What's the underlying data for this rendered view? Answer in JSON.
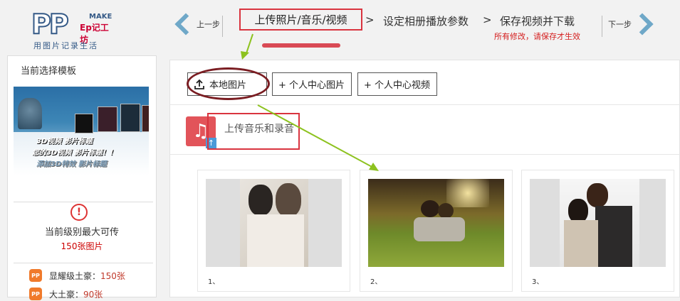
{
  "header": {
    "logo": {
      "pp": "PP",
      "make": "MAKE",
      "brand": "Ep记工坊",
      "slogan": "用图片记录生活"
    },
    "prev_label": "上一步",
    "next_label": "下一步",
    "steps": [
      {
        "label": "上传照片/音乐/视频",
        "active": true
      },
      {
        "label": "设定相册播放参数",
        "active": false
      },
      {
        "label": "保存视频并下载",
        "active": false
      }
    ],
    "separator": ">",
    "save_warning": "所有修改，请保存才生效"
  },
  "sidebar": {
    "title": "当前选择模板",
    "template_preview": {
      "text_line1": "3D视频 影片标题",
      "text_line2": "您的3D视频 影片标题！！",
      "text_line3": "添加3D特效 影片标题"
    },
    "limit_label": "当前级别最大可传",
    "limit_value": "150张图片",
    "levels": [
      {
        "badge": "PP",
        "name": "显耀级土豪：",
        "count": "150张"
      },
      {
        "badge": "PP",
        "name": "大土豪：",
        "count": "90张"
      }
    ]
  },
  "main": {
    "upload_buttons": [
      "本地图片",
      "+ 个人中心图片",
      "+ 个人中心视频"
    ],
    "music_label": "上传音乐和录音",
    "photos": [
      {
        "caption": "1、"
      },
      {
        "caption": "2、"
      },
      {
        "caption": "3、"
      }
    ]
  },
  "colors": {
    "accent_red": "#d9343f",
    "annotation_green": "#8dc21f",
    "logo_blue": "#355a87",
    "chevron": "#6fa8c8",
    "warning": "#d41d1d"
  },
  "icons": [
    "chevron-left-icon",
    "chevron-right-icon",
    "upload-icon",
    "music-icon",
    "alert-icon",
    "level-badge-icon"
  ]
}
